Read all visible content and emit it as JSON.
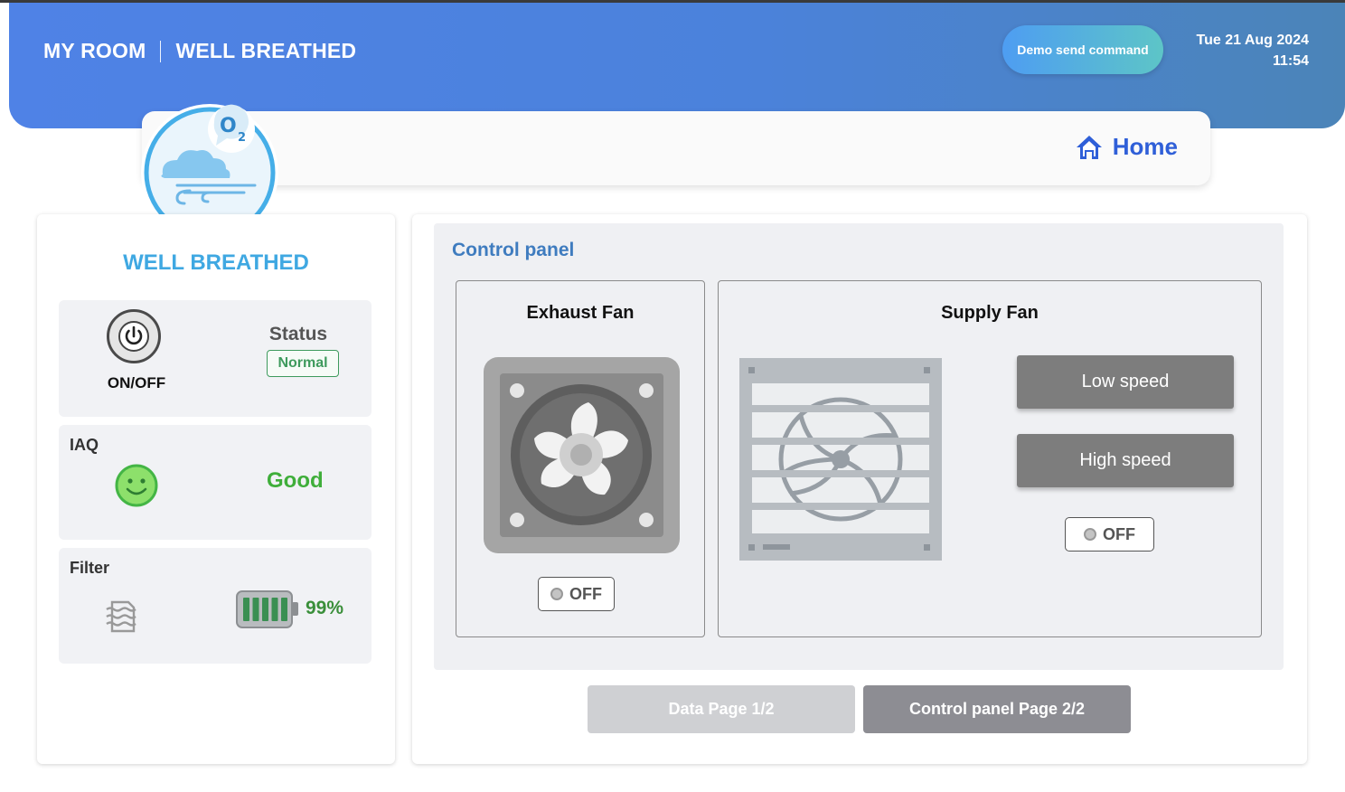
{
  "header": {
    "room_label": "MY ROOM",
    "app_name": "WELL BREATHED",
    "demo_button": "Demo send command",
    "date": "Tue 21 Aug 2024",
    "time": "11:54",
    "gradient": [
      "#4f82e6",
      "#4b84b8"
    ]
  },
  "nav": {
    "home_label": "Home",
    "home_icon": "house-icon"
  },
  "device": {
    "title": "WELL BREATHED",
    "power": {
      "label": "ON/OFF",
      "icon": "power-icon"
    },
    "status": {
      "label": "Status",
      "value": "Normal",
      "color": "#3e9a5d"
    },
    "iaq": {
      "label": "IAQ",
      "value": "Good",
      "icon": "smiley-icon",
      "color": "#3fae3a"
    },
    "filter": {
      "label": "Filter",
      "value": "99%",
      "level": 0.99,
      "icon": "filter-icon",
      "battery_icon": "battery-icon"
    }
  },
  "control_panel": {
    "title": "Control panel",
    "exhaust_fan": {
      "title": "Exhaust Fan",
      "toggle_label": "OFF"
    },
    "supply_fan": {
      "title": "Supply Fan",
      "low_speed_label": "Low speed",
      "high_speed_label": "High speed",
      "toggle_label": "OFF"
    }
  },
  "pagination": {
    "page1_label": "Data Page 1/2",
    "page2_label": "Control panel Page 2/2",
    "active_page": 2
  },
  "colors": {
    "accent": "#3fa8e2",
    "panel_title": "#3f7cbf",
    "button_gray": "#7d7d7d"
  }
}
